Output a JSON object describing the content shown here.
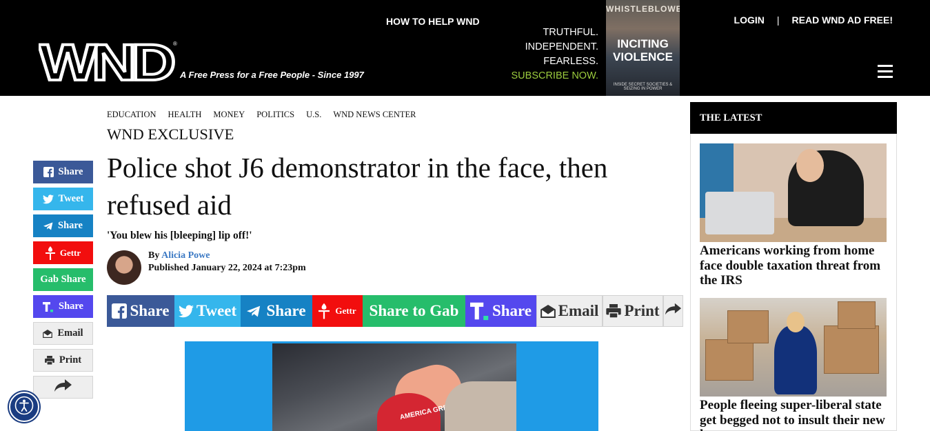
{
  "header": {
    "logo_text": "WND",
    "tagline": "A Free Press for a Free People - Since 1997",
    "help_link": "HOW TO HELP WND",
    "promo": {
      "line1": "TRUTHFUL.",
      "line2": "INDEPENDENT.",
      "line3": "FEARLESS.",
      "subscribe": "SUBSCRIBE NOW.",
      "subscribe_color": "#9ccc3e"
    },
    "book": {
      "series": "WHISTLEBLOWER",
      "title": "INCITING VIOLENCE",
      "subtitle": "INSIDE SECRET SOCIETIES & SEIZING IN POWER"
    },
    "login": "LOGIN",
    "separator": "|",
    "ad_free": "READ WND AD FREE!"
  },
  "category_nav": [
    "EDUCATION",
    "HEALTH",
    "MONEY",
    "POLITICS",
    "U.S.",
    "WND NEWS CENTER"
  ],
  "article": {
    "kicker": "WND EXCLUSIVE",
    "headline": "Police shot J6 demonstrator in the face, then refused aid",
    "dek": "'You blew his [bleeping] lip off!'",
    "by_label": "By",
    "author": "Alicia Powe",
    "published": "Published January 22, 2024 at 7:23pm",
    "image_hat_text": "AMERICA GREAT AGAIN"
  },
  "side_share": [
    {
      "label": "Share",
      "icon": "facebook-icon",
      "color": "#3b5998"
    },
    {
      "label": "Tweet",
      "icon": "twitter-icon",
      "color": "#35b6ec"
    },
    {
      "label": "Share",
      "icon": "telegram-icon",
      "color": "#1682c4"
    },
    {
      "label": "Gettr",
      "icon": "gettr-icon",
      "color": "#f20e0e"
    },
    {
      "label": "Gab Share",
      "icon": "",
      "color": "#26bd6b"
    },
    {
      "label": "Share",
      "icon": "truth-social-icon",
      "color": "#5448ee"
    },
    {
      "label": "Email",
      "icon": "email-icon",
      "color": "#eeeeee"
    },
    {
      "label": "Print",
      "icon": "print-icon",
      "color": "#eeeeee"
    },
    {
      "label": "",
      "icon": "share-arrow-icon",
      "color": "#eeeeee"
    }
  ],
  "share_bar": [
    {
      "label": "Share",
      "icon": "facebook-icon",
      "color": "#3b5998"
    },
    {
      "label": "Tweet",
      "icon": "twitter-icon",
      "color": "#35b6ec"
    },
    {
      "label": "Share",
      "icon": "telegram-icon",
      "color": "#1682c4"
    },
    {
      "label": "Gettr",
      "icon": "gettr-icon",
      "color": "#f20e0e"
    },
    {
      "label": "Share to Gab",
      "icon": "",
      "color": "#26bd6b"
    },
    {
      "label": "Share",
      "icon": "truth-social-icon",
      "color": "#5448ee"
    },
    {
      "label": "Email",
      "icon": "email-icon",
      "color": "#eeeeee"
    },
    {
      "label": "Print",
      "icon": "print-icon",
      "color": "#eeeeee"
    },
    {
      "label": "",
      "icon": "share-arrow-icon",
      "color": "#eeeeee"
    }
  ],
  "latest": {
    "heading": "THE LATEST",
    "items": [
      {
        "title": "Americans working from home face double taxation threat from the IRS"
      },
      {
        "title": "People fleeing super-liberal state get begged not to insult their new hosts"
      }
    ]
  }
}
